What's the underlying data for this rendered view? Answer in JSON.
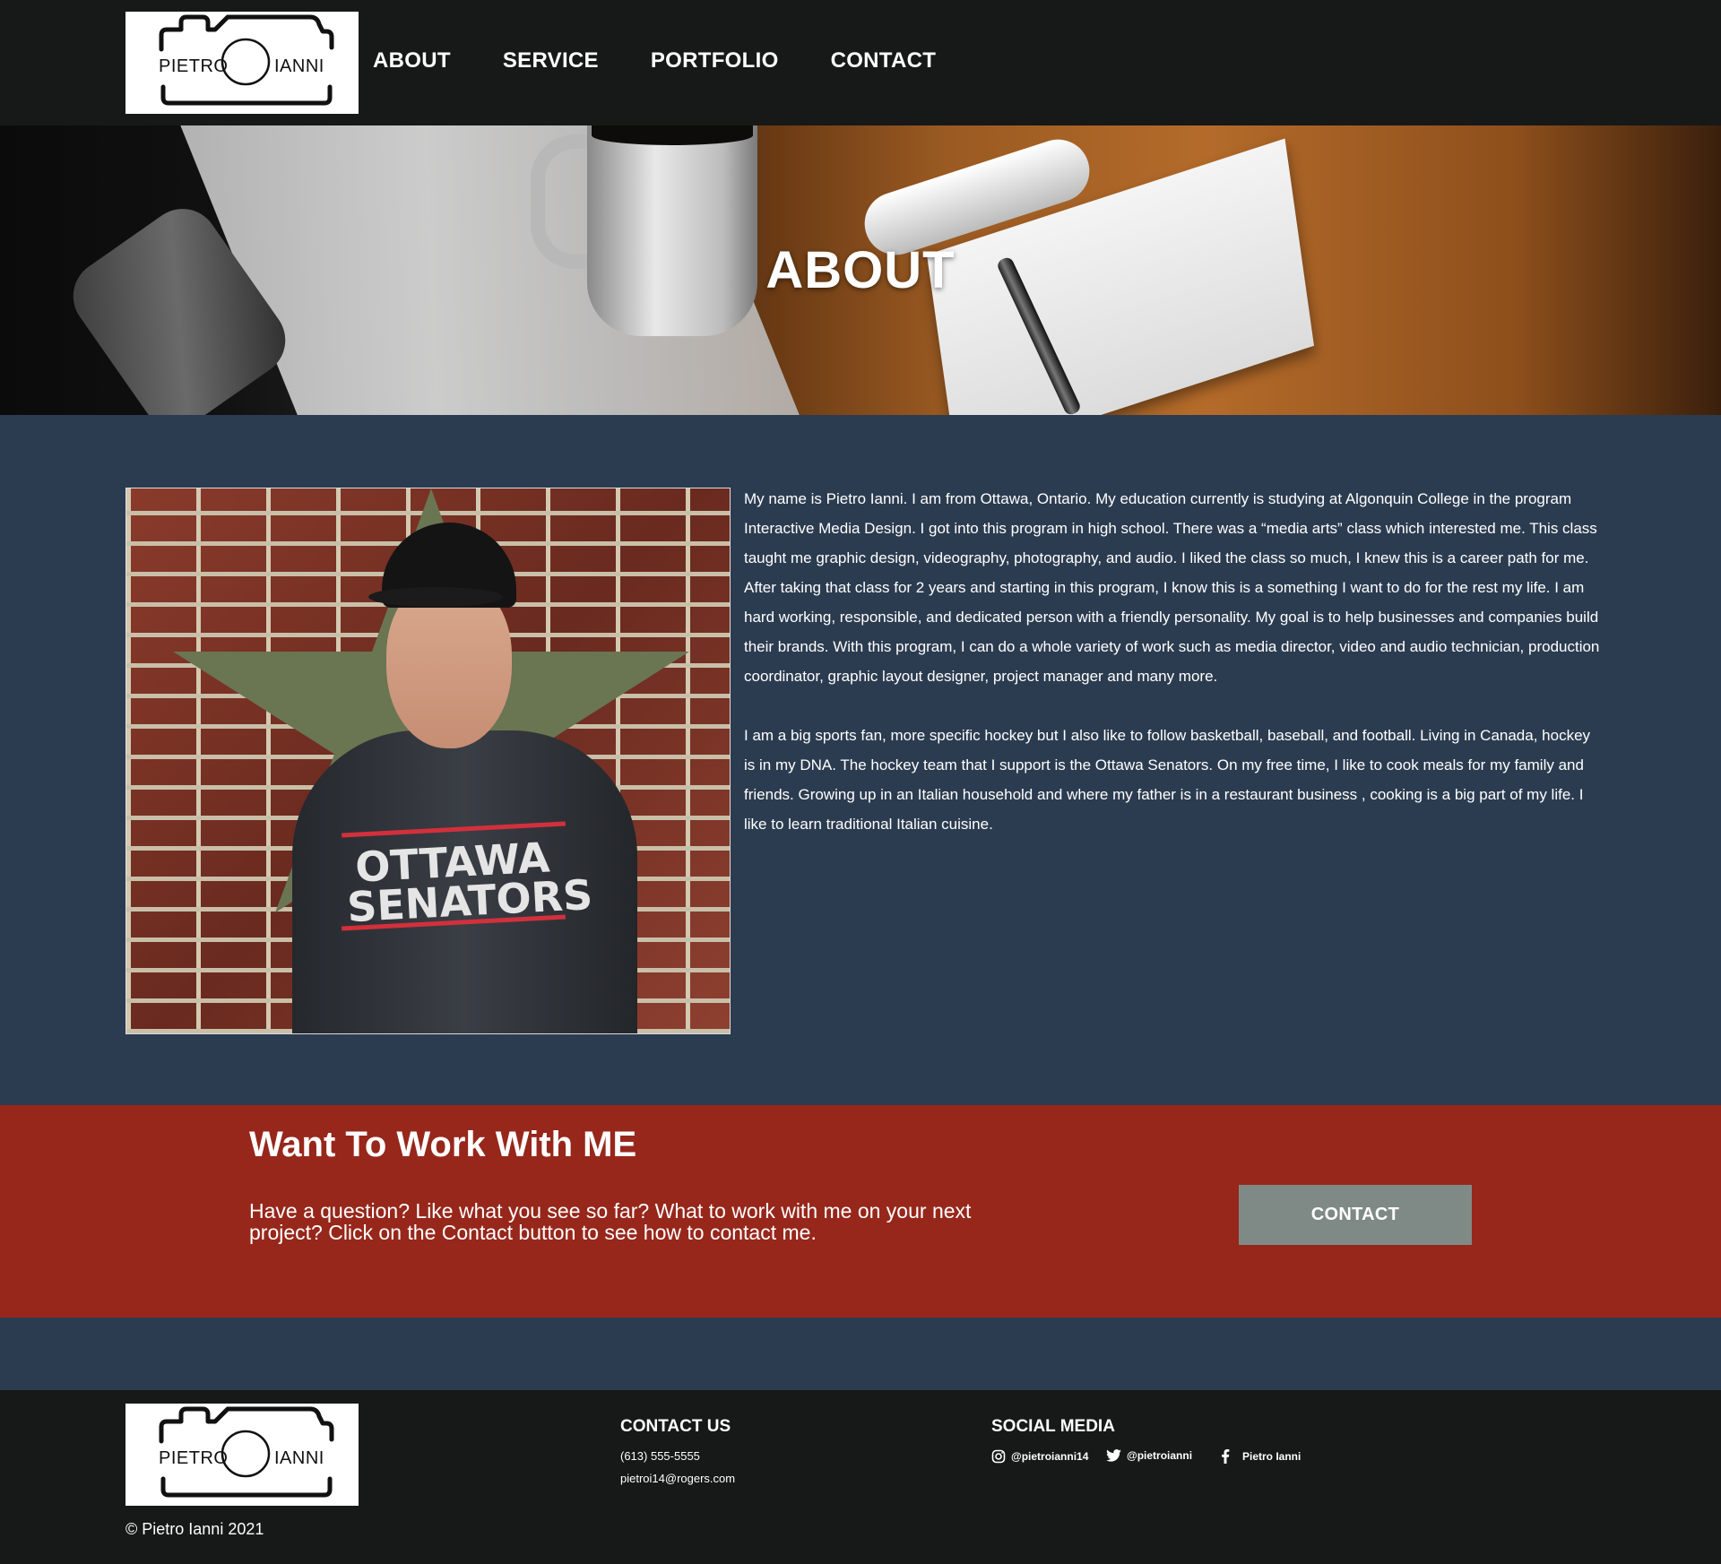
{
  "logo": {
    "word_left": "PIETRO",
    "word_right": "IANNI"
  },
  "nav": {
    "items": [
      "ABOUT",
      "SERVICE",
      "PORTFOLIO",
      "CONTACT"
    ]
  },
  "hero": {
    "title": "ABOUT"
  },
  "about": {
    "paragraphs": [
      "My name is Pietro Ianni. I am from Ottawa, Ontario. My education currently is studying at Algonquin College in the program Interactive Media Design. I got into this program  in high school. There was a “media arts” class which interested me. This class taught me graphic design, videography, photography, and audio. I liked the class so much, I knew this is a career path for me. After taking that class for 2 years and starting in this program, I know this is a something I want to do for the rest my life. I am hard working, responsible, and dedicated person with a friendly personality. My goal is to help businesses and companies build their brands. With this program, I can do a whole variety of work such as media director, video and audio technician, production coordinator, graphic layout designer, project manager and many more.",
      "I am a big sports fan, more specific hockey but I also like to follow basketball, baseball, and football. Living in Canada, hockey is in my DNA. The hockey team that I support is the Ottawa Senators. On my free time, I like to cook meals for my family and friends. Growing up in an Italian household and where my father is in a restaurant business , cooking is a big part of my life. I like to learn traditional Italian cuisine."
    ],
    "photo_shirt_text": "OTTAWA SENATORS"
  },
  "cta": {
    "title": "Want To Work With ME",
    "text": "Have a question? Like what you see so far? What to work with me on your next project? Click on the Contact button to see how to contact me.",
    "button": "CONTACT"
  },
  "footer": {
    "copyright": "© Pietro Ianni 2021",
    "contact_title": "CONTACT US",
    "phone": "(613) 555-5555",
    "email": "pietroi14@rogers.com",
    "social_title": "SOCIAL MEDIA",
    "social": [
      {
        "icon": "instagram-icon",
        "label": "@pietroianni14"
      },
      {
        "icon": "twitter-icon",
        "label": "@pietroianni"
      },
      {
        "icon": "facebook-icon",
        "label": "Pietro Ianni"
      }
    ]
  },
  "colors": {
    "nav_bg": "#171818",
    "body_bg": "#2c3c50",
    "cta_bg": "#97271b",
    "cta_button": "#7f8a86"
  }
}
